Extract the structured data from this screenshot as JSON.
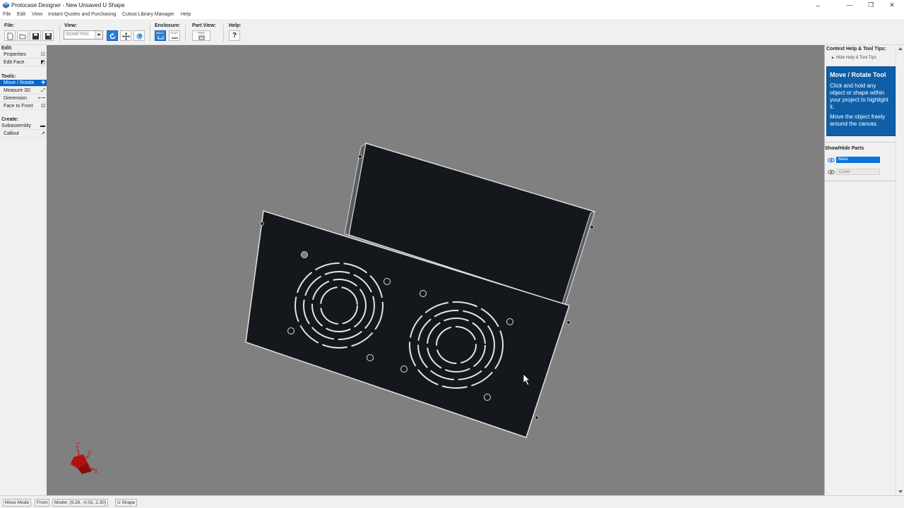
{
  "window": {
    "title": "Protocase Designer - New Unsaved U Shape"
  },
  "menu": [
    "File",
    "Edit",
    "View",
    "Instant Quotes and Purchasing",
    "Cutout Library Manager",
    "Help"
  ],
  "toolbar": {
    "file_label": "File:",
    "view_label": "View:",
    "view_value": "ISOMETRIC",
    "enclosure_label": "Enclosure:",
    "bent_label": "BENT",
    "flat_label": "FLAT",
    "partview_label": "Part View:",
    "tree_label": "TREE",
    "help_label": "Help:",
    "help_button": "?"
  },
  "left_panel": {
    "edit_label": "Edit:",
    "edit_items": [
      "Properties",
      "Edit Face"
    ],
    "tools_label": "Tools:",
    "tool_items": [
      "Move / Rotate",
      "Measure 3D",
      "Dimension",
      "Face to Front"
    ],
    "active_tool": "Move / Rotate",
    "create_label": "Create:",
    "create_items": [
      "Subassembly",
      "Callout"
    ]
  },
  "right_panel": {
    "header": "Context Help & Tool Tips:",
    "hide_link": "Hide Help & Tool Tips",
    "help_title": "Move / Rotate Tool",
    "help_text_1": "Click and hold any object or shape within your project to highlight it.",
    "help_text_2": "Move the object freely around the canvas.",
    "show_hide_label": "Show/Hide Parts",
    "parts": [
      {
        "name": "Base",
        "visible": true
      },
      {
        "name": "Cover",
        "visible": false
      }
    ]
  },
  "axes": {
    "z": "Z",
    "y": "Y",
    "x": "X"
  },
  "status": {
    "mode": "Move Mode",
    "view": "Front",
    "model": "Model: (9.26, -0.02, 2.30)",
    "shape": "U Shape"
  },
  "colors": {
    "canvas": "#808080",
    "panel": "#14181d",
    "accent": "#0d5fa8",
    "active_tool": "#0a63c9"
  }
}
